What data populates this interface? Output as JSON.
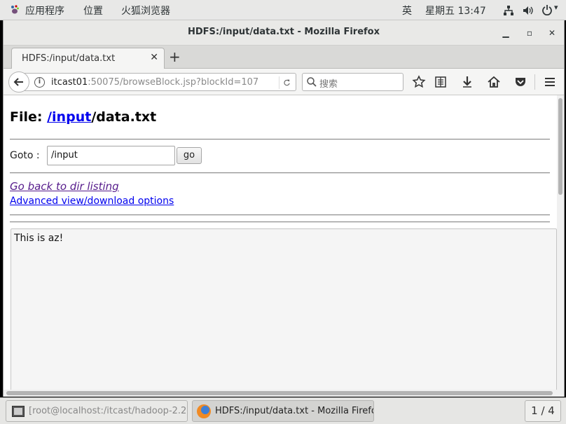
{
  "top_panel": {
    "applications": "应用程序",
    "places": "位置",
    "browser_app": "火狐浏览器",
    "input_method": "英",
    "clock": "星期五 13:47"
  },
  "window": {
    "title": "HDFS:/input/data.txt - Mozilla Firefox"
  },
  "tab": {
    "title": "HDFS:/input/data.txt",
    "new_tab": "+"
  },
  "urlbar": {
    "host": "itcast01",
    "rest": ":50075/browseBlock.jsp?blockId=107"
  },
  "search": {
    "placeholder": "搜索"
  },
  "page": {
    "file_label": "File: ",
    "dir_link": "/input",
    "file_name": "/data.txt",
    "goto_label": "Goto :",
    "goto_value": "/input",
    "go_button": "go",
    "back_link": "Go back to dir listing",
    "advanced_link": "Advanced view/download options",
    "file_content": "This is az!"
  },
  "taskbar": {
    "terminal_task": "[root@localhost:/itcast/hadoop-2.2…",
    "firefox_task": "HDFS:/input/data.txt - Mozilla Firefox",
    "workspace": "1 / 4"
  },
  "icons": {
    "gnome_foot": "gnome-foot-icon",
    "network": "network-icon",
    "volume": "volume-icon",
    "power": "power-icon"
  }
}
